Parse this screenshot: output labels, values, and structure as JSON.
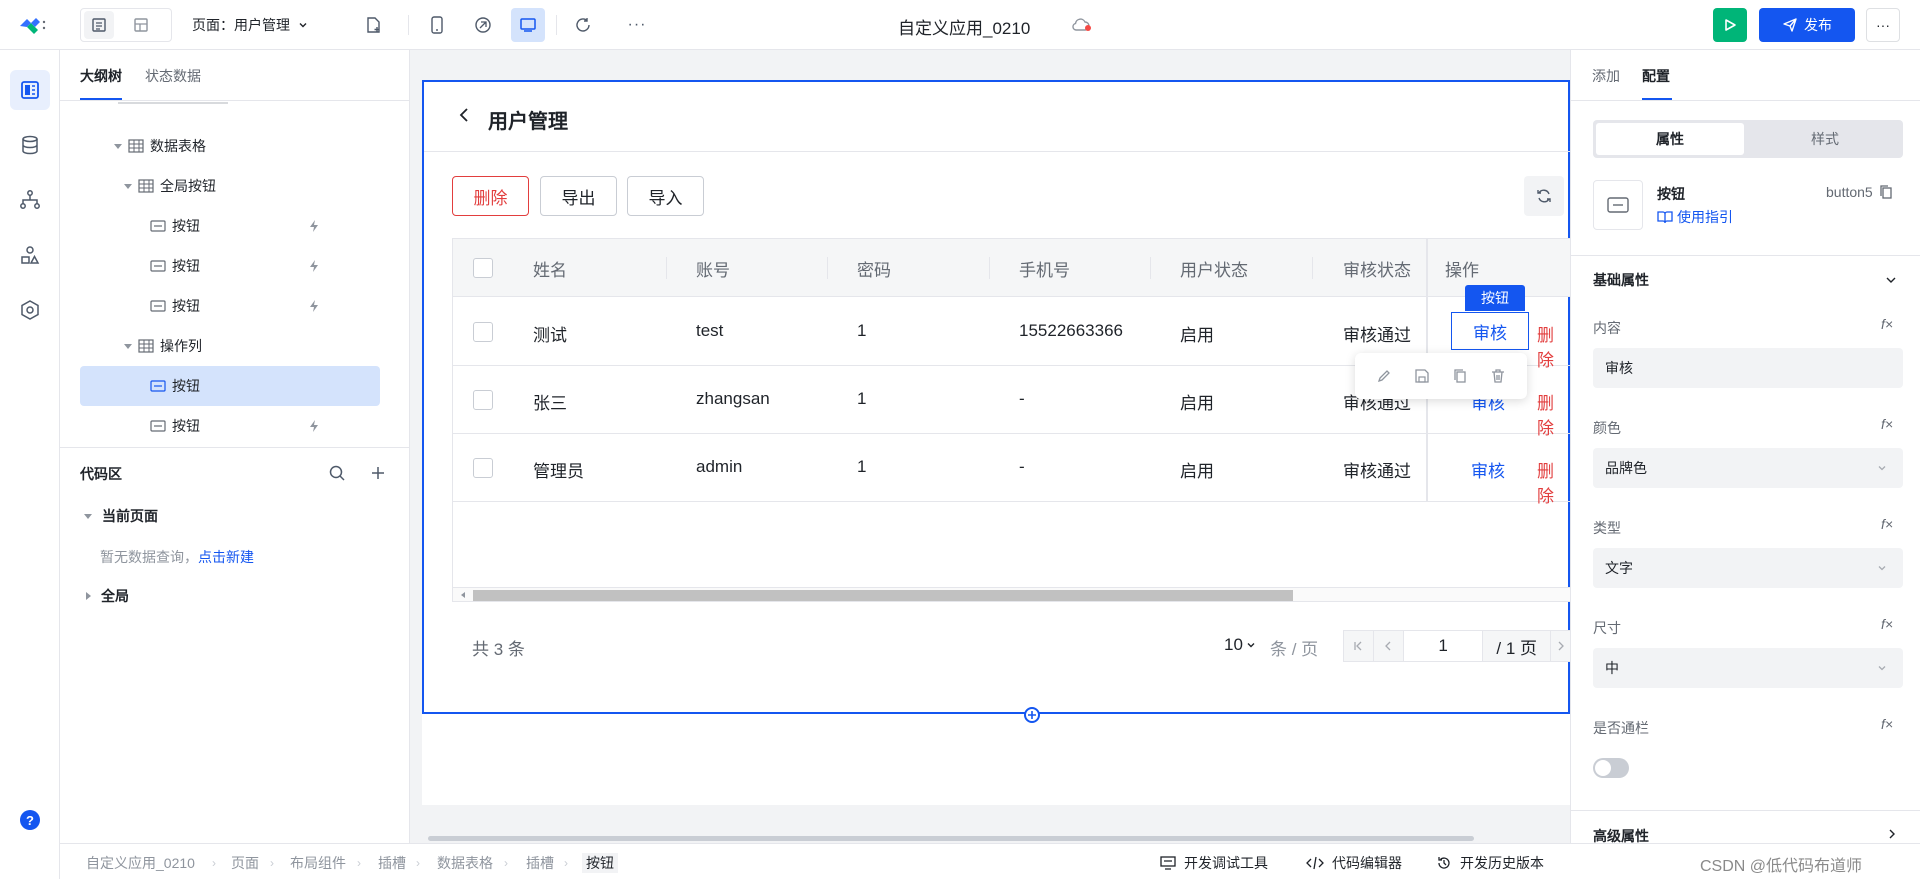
{
  "topbar": {
    "page_prefix": "页面：",
    "page_name": "用户管理",
    "app_title": "自定义应用_0210",
    "publish_label": "发布",
    "more_label": "···"
  },
  "left_panel": {
    "tabs": [
      "大纲树",
      "状态数据"
    ],
    "tree": [
      {
        "label": "数据表格"
      },
      {
        "label": "全局按钮"
      },
      {
        "label": "按钮"
      },
      {
        "label": "按钮"
      },
      {
        "label": "按钮"
      },
      {
        "label": "操作列"
      },
      {
        "label": "按钮"
      },
      {
        "label": "按钮"
      }
    ],
    "code_title": "代码区",
    "current_page": "当前页面",
    "no_query": "暂无数据查询，",
    "create_link": "点击新建",
    "global": "全局"
  },
  "canvas": {
    "page_title": "用户管理",
    "buttons": {
      "delete": "删除",
      "export": "导出",
      "import": "导入"
    },
    "columns": [
      "姓名",
      "账号",
      "密码",
      "手机号",
      "用户状态",
      "审核状态",
      "操作"
    ],
    "rows": [
      {
        "name": "测试",
        "account": "test",
        "password": "1",
        "phone": "15522663366",
        "status": "启用",
        "audit": "审核通过"
      },
      {
        "name": "张三",
        "account": "zhangsan",
        "password": "1",
        "phone": "-",
        "status": "启用",
        "audit": "审核通过"
      },
      {
        "name": "管理员",
        "account": "admin",
        "password": "1",
        "phone": "-",
        "status": "启用",
        "audit": "审核通过"
      }
    ],
    "action_review": "审核",
    "action_delete": "删除",
    "selected_tag": "按钮",
    "total": "共 3 条",
    "page_size": "10",
    "per_page": "条 / 页",
    "current_page": "1",
    "total_pages": "/ 1 页"
  },
  "right_panel": {
    "tabs": [
      "添加",
      "配置"
    ],
    "segments": [
      "属性",
      "样式"
    ],
    "component_name": "按钮",
    "component_id": "button5",
    "guide_link": "使用指引",
    "basic_section": "基础属性",
    "fields": [
      {
        "label": "内容",
        "value": "审核"
      },
      {
        "label": "颜色",
        "value": "品牌色"
      },
      {
        "label": "类型",
        "value": "文字"
      },
      {
        "label": "尺寸",
        "value": "中"
      }
    ],
    "block_label": "是否通栏",
    "advanced_section": "高级属性"
  },
  "bottombar": {
    "breadcrumbs": [
      "自定义应用_0210",
      "页面",
      "布局组件",
      "插槽",
      "数据表格",
      "插槽",
      "按钮"
    ],
    "tools": [
      "开发调试工具",
      "代码编辑器",
      "开发历史版本"
    ],
    "watermark": "CSDN @低代码布道师"
  },
  "colors": {
    "brand": "#1456f0",
    "danger": "#e23e3e",
    "run_green": "#00b578"
  }
}
